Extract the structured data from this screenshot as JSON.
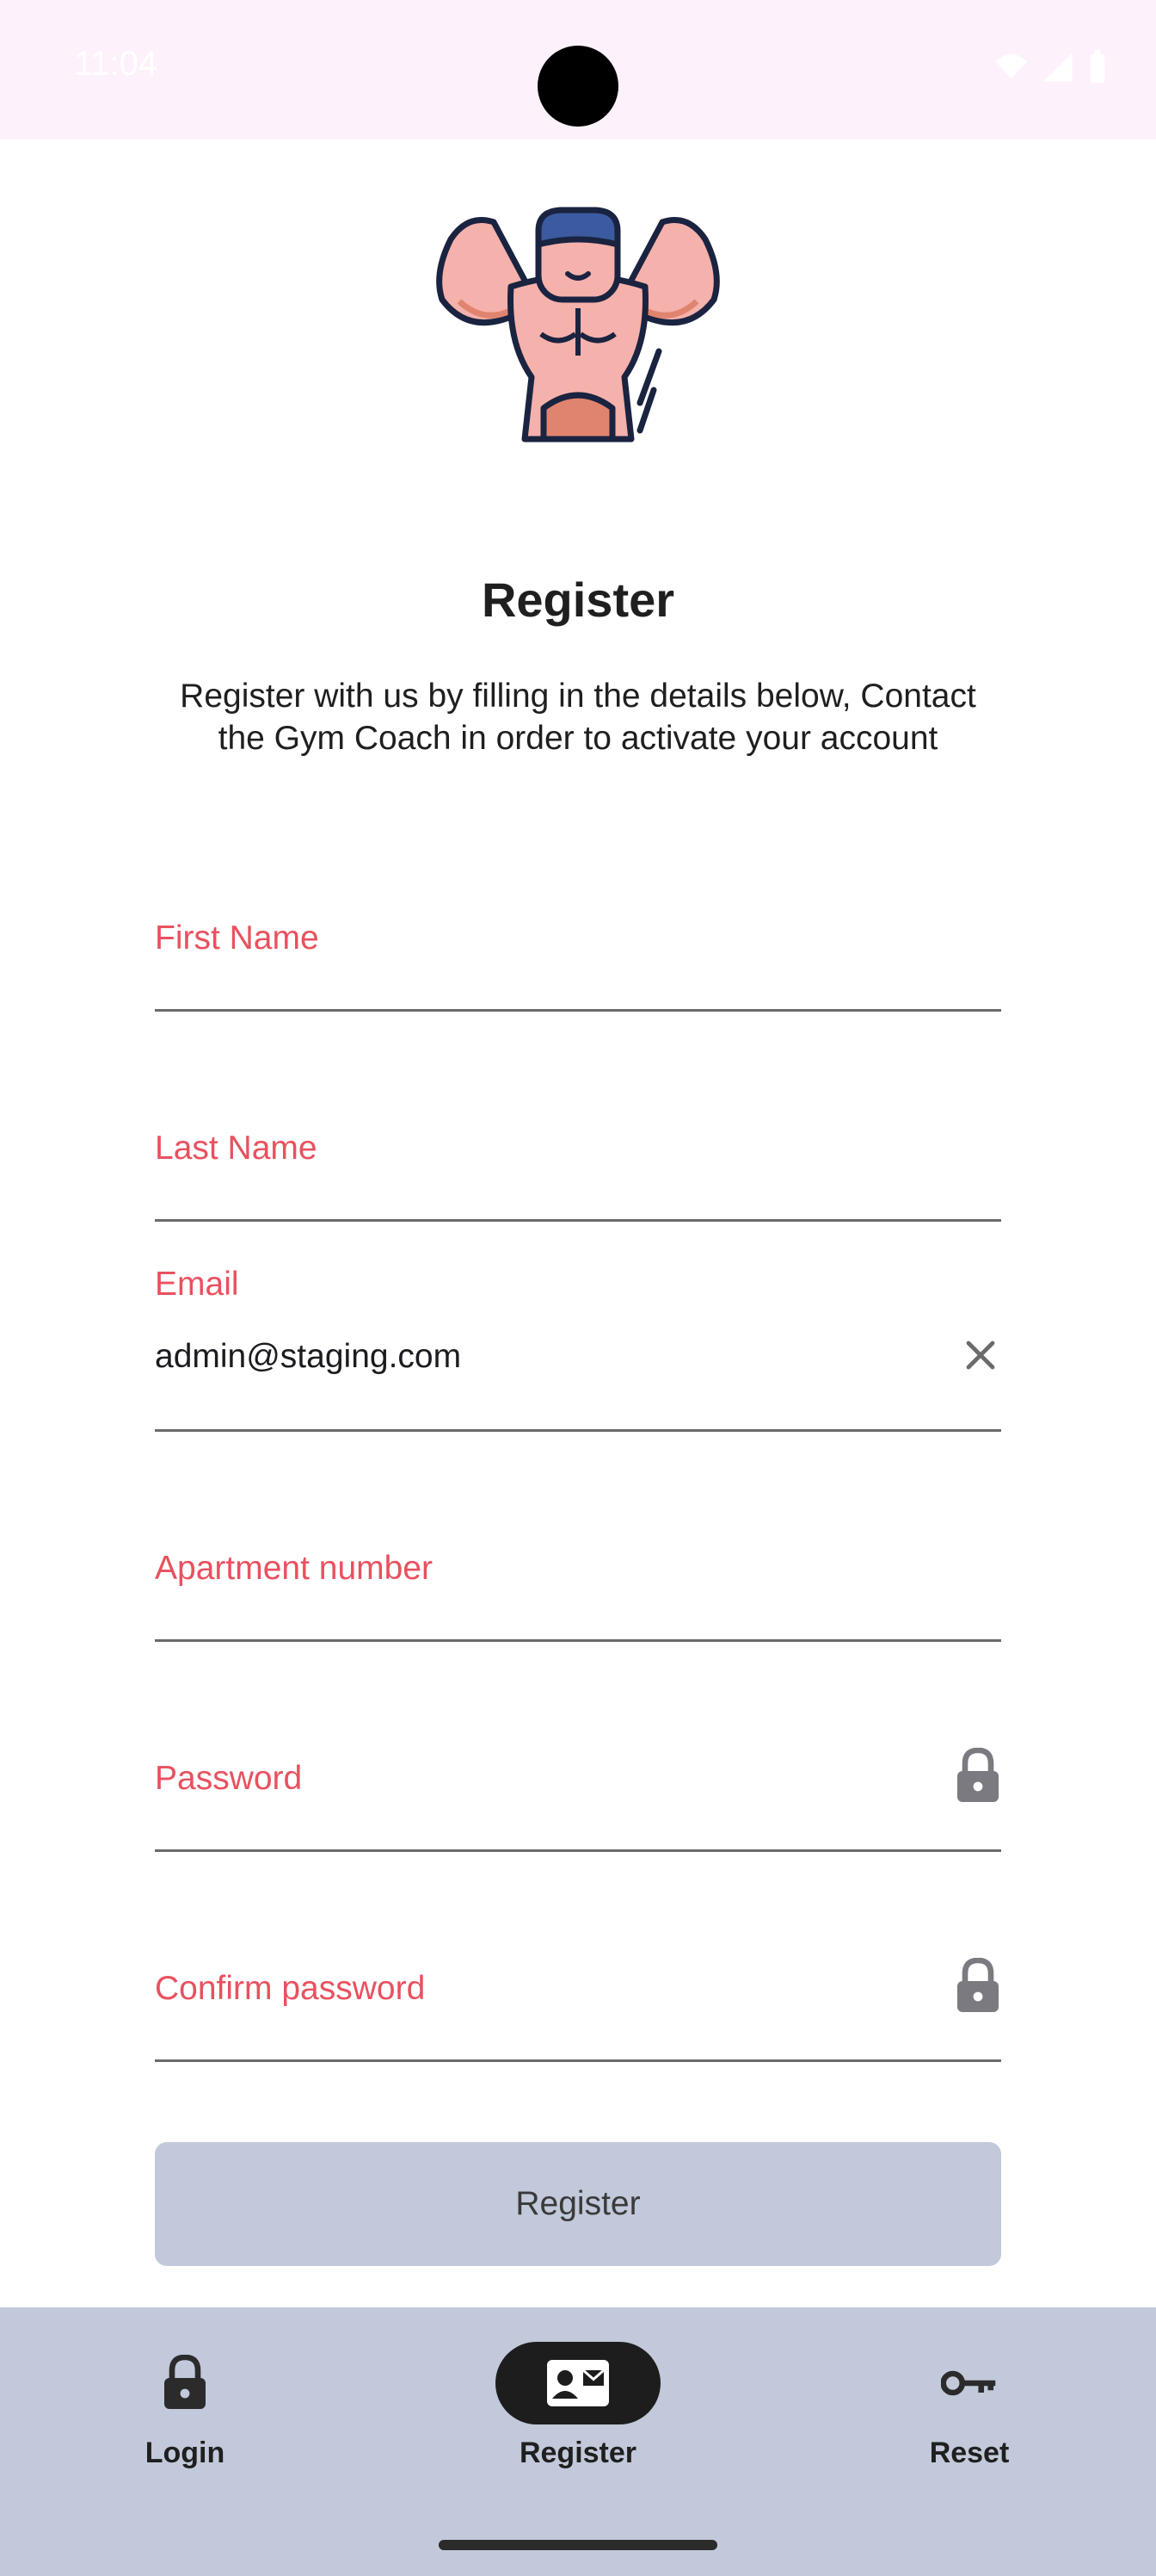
{
  "status_bar": {
    "time": "11:04"
  },
  "page": {
    "title": "Register",
    "subtitle": "Register with us by filling in the details below, Contact the Gym Coach in order to activate your account"
  },
  "form": {
    "first_name": {
      "label": "First Name",
      "value": ""
    },
    "last_name": {
      "label": "Last Name",
      "value": ""
    },
    "email": {
      "label": "Email",
      "value": "admin@staging.com"
    },
    "apartment": {
      "label": "Apartment number",
      "value": ""
    },
    "password": {
      "label": "Password",
      "value": ""
    },
    "confirm_password": {
      "label": "Confirm password",
      "value": ""
    },
    "submit_label": "Register"
  },
  "nav": {
    "items": [
      {
        "label": "Login",
        "icon": "lock-icon"
      },
      {
        "label": "Register",
        "icon": "contact-card-icon",
        "active": true
      },
      {
        "label": "Reset",
        "icon": "key-icon"
      }
    ]
  },
  "colors": {
    "accent_label": "#e8515f",
    "nav_background": "#c1c9da",
    "button_background": "#c1c9da",
    "status_bar_background": "#fdf1fb"
  }
}
